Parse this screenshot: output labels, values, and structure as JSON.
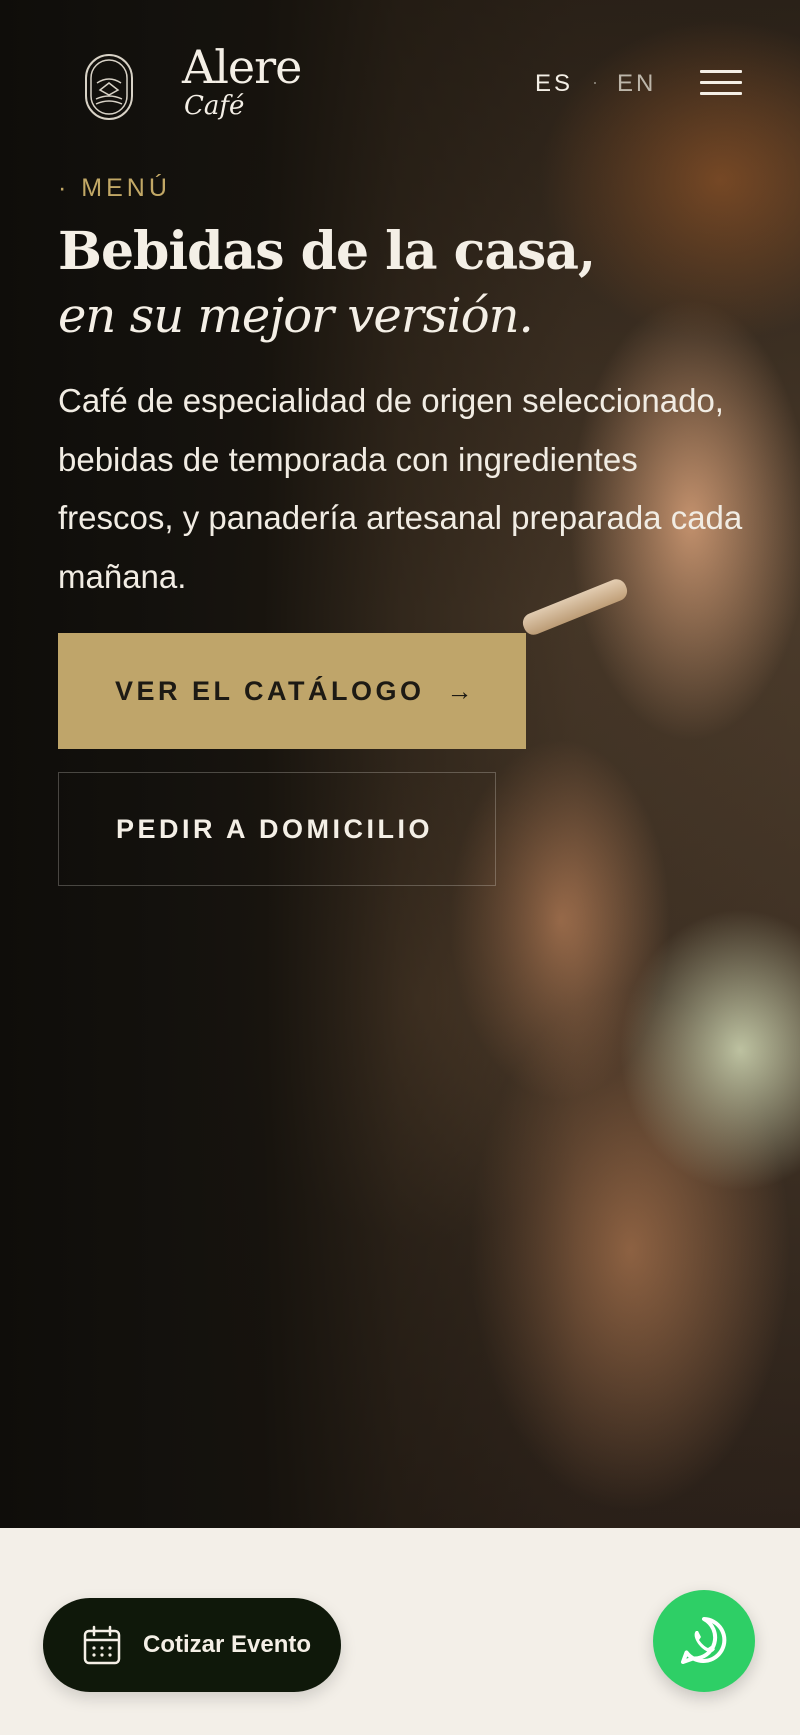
{
  "header": {
    "brand_name": "Alere",
    "brand_sub": "Café",
    "lang_es": "ES",
    "lang_separator": "·",
    "lang_en": "EN",
    "logo_icon": "cafe-emblem-icon",
    "menu_icon": "hamburger-menu-icon"
  },
  "hero": {
    "eyebrow": "· MENÚ",
    "title_line1": "Bebidas de la casa,",
    "title_line2": "en su mejor versión.",
    "lead": "Café de especialidad de origen seleccionado, bebidas de temporada con ingredientes frescos, y panadería artesanal preparada cada mañana.",
    "primary_cta": "VER EL CATÁLOGO",
    "primary_cta_arrow": "→",
    "secondary_cta": "PEDIR A DOMICILIO"
  },
  "floating": {
    "event_label": "Cotizar Evento",
    "event_icon": "calendar-icon",
    "whatsapp_icon": "whatsapp-icon"
  },
  "colors": {
    "accent_gold": "#bfa56a",
    "dark_bg": "#0f0d0a",
    "cream": "#f3efe8",
    "whatsapp_green": "#2ecf66",
    "event_dark": "#0f180a"
  }
}
